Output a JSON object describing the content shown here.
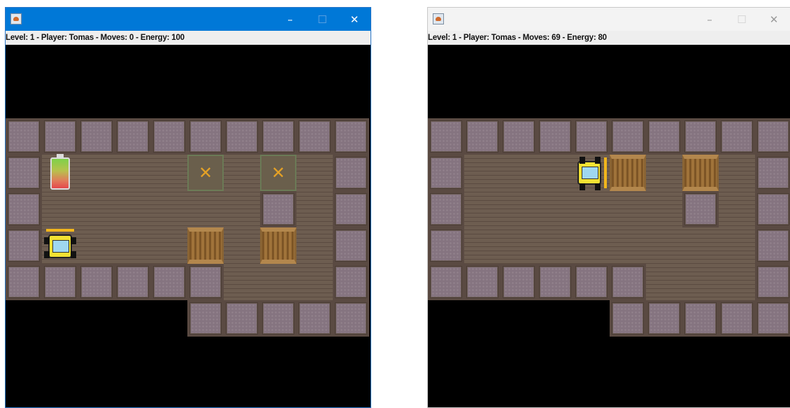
{
  "windows": [
    {
      "id": "before",
      "focused": true,
      "app_icon": "java-cup-icon",
      "controls": {
        "minimize": "–",
        "maximize": "☐",
        "close": "✕"
      },
      "status": "Level: 1 - Player: Tomas - Moves: 0 - Energy: 100",
      "target_marker": "✕"
    },
    {
      "id": "after",
      "focused": false,
      "app_icon": "java-cup-icon",
      "controls": {
        "minimize": "–",
        "maximize": "☐",
        "close": "✕"
      },
      "status": "Level: 1 - Player: Tomas - Moves: 69 - Energy: 80"
    }
  ],
  "colors": {
    "focused_titlebar": "#0078d7",
    "target_marker": "#e4a126",
    "truck": "#f2e233"
  }
}
